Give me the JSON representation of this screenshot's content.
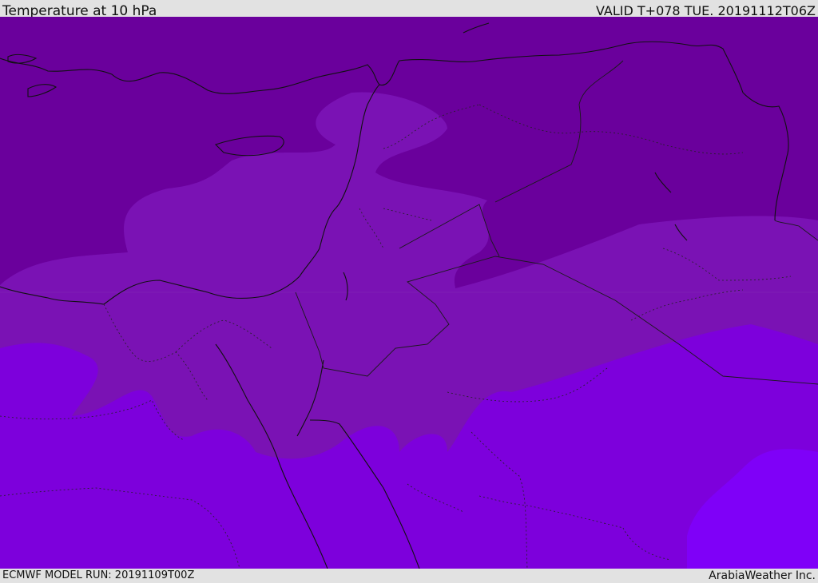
{
  "header": {
    "title": "Temperature at 10 hPa",
    "valid_time": "VALID T+078 TUE. 20191112T06Z"
  },
  "footer": {
    "model_run": "ECMWF MODEL RUN: 20191109T00Z",
    "credit": "ArabiaWeather Inc."
  },
  "map": {
    "field": "temperature",
    "level": "10 hPa",
    "colors": {
      "band_coldest": "#6a009c",
      "band_cold": "#7a12b4",
      "band_mid": "#7d00dc",
      "band_warm": "#7f00f8",
      "coastline": "#111111",
      "border": "#222222"
    }
  }
}
